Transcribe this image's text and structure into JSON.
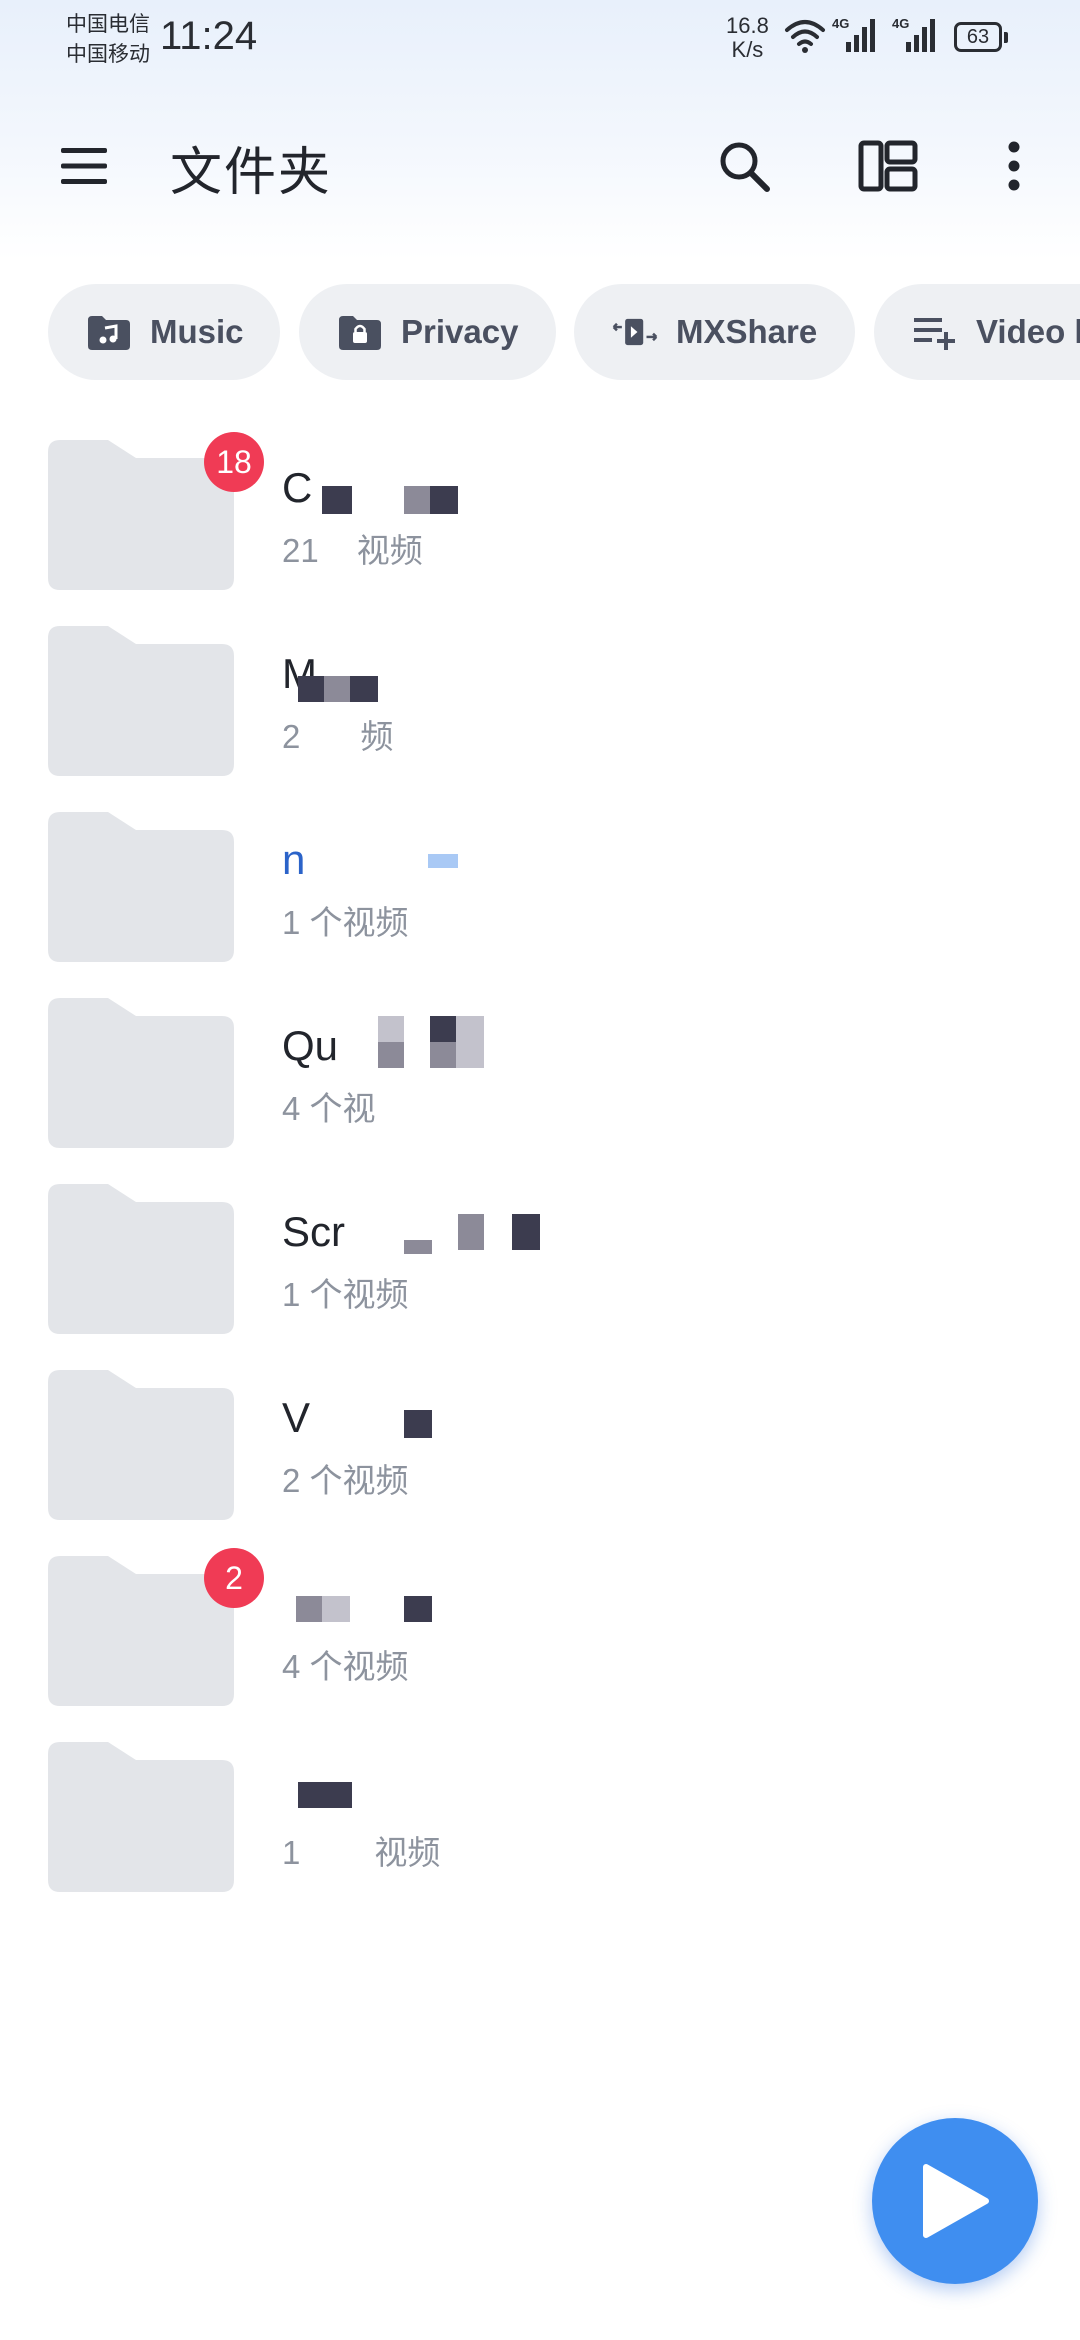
{
  "status_bar": {
    "carrier_1": "中国电信",
    "carrier_2": "中国移动",
    "time": "11:24",
    "net_speed_value": "16.8",
    "net_speed_unit": "K/s",
    "signal_1_label": "4G",
    "signal_2_label": "4G",
    "battery": "63"
  },
  "header": {
    "title": "文件夹"
  },
  "chips": [
    {
      "label": "Music",
      "icon": "music-folder-icon"
    },
    {
      "label": "Privacy",
      "icon": "lock-folder-icon"
    },
    {
      "label": "MXShare",
      "icon": "share-transfer-icon"
    },
    {
      "label": "Video l",
      "icon": "playlist-add-icon"
    }
  ],
  "folders": [
    {
      "name": "C",
      "meta": "21",
      "meta_suffix": "视频",
      "badge": "18"
    },
    {
      "name": "M",
      "meta": "2",
      "meta_suffix": "频",
      "badge": ""
    },
    {
      "name": "n",
      "meta": "1 个视频",
      "meta_suffix": "",
      "badge": ""
    },
    {
      "name": "Qu",
      "meta": "4 个视",
      "meta_suffix": "",
      "badge": ""
    },
    {
      "name": "Scr",
      "meta": "1 个视频",
      "meta_suffix": "",
      "badge": ""
    },
    {
      "name": "V",
      "meta": "2 个视频",
      "meta_suffix": "",
      "badge": ""
    },
    {
      "name": "",
      "meta": "4 个视频",
      "meta_suffix": "",
      "badge": "2"
    },
    {
      "name": "",
      "meta": "1",
      "meta_suffix": "视频",
      "badge": ""
    }
  ],
  "colors": {
    "accent": "#3f8ef0",
    "badge": "#f03b55",
    "folder": "#e3e5e9",
    "chip_bg": "#eef0f3"
  }
}
